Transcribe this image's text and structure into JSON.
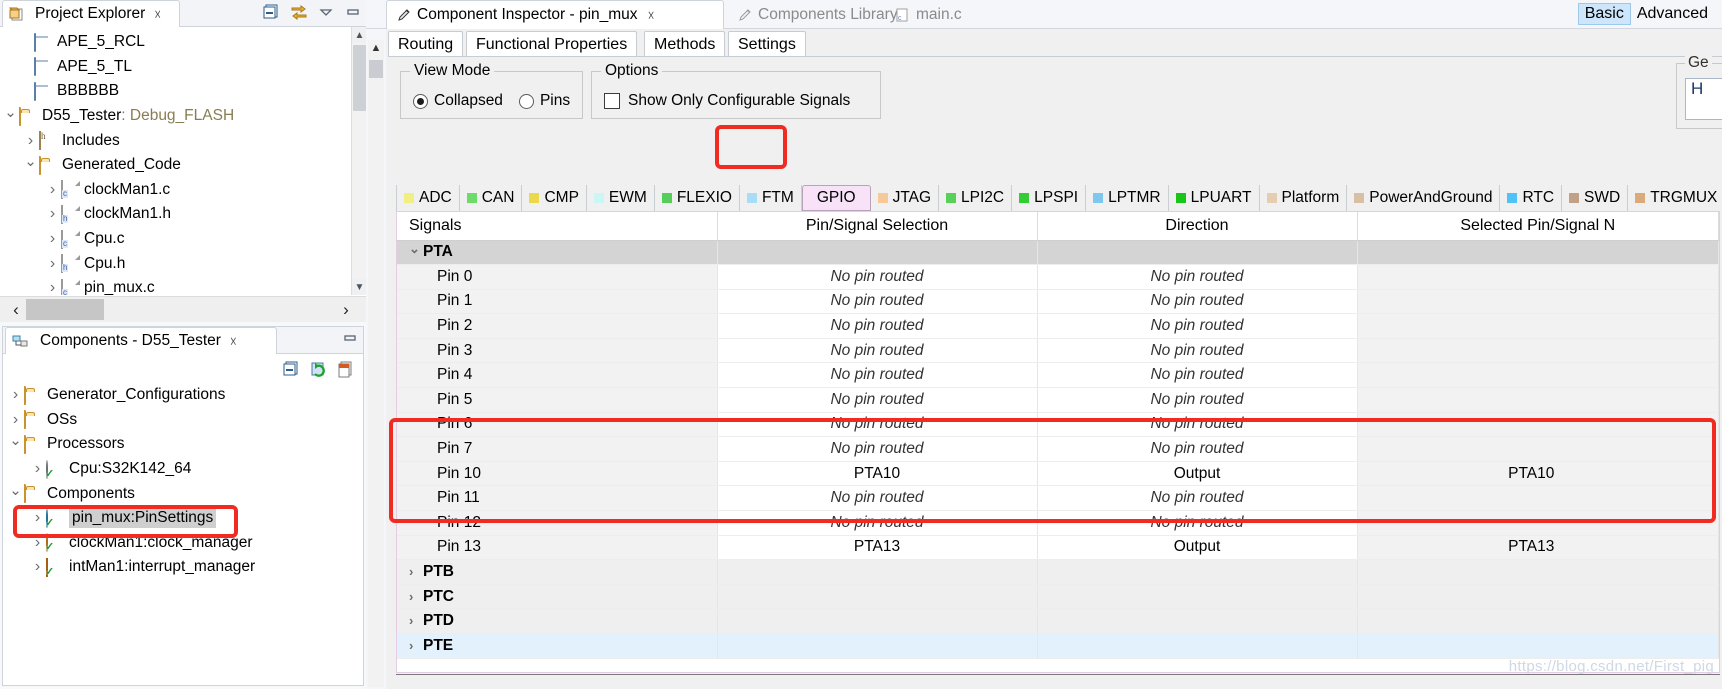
{
  "project_explorer": {
    "tab_title": "Project Explorer",
    "close_glyph": "☓",
    "toolbar": [
      "collapse-all-icon",
      "link-with-editor-icon",
      "view-menu-icon",
      "minimize-icon"
    ],
    "tree": [
      {
        "label": "APE_5_RCL",
        "icon": "project-folder-icon",
        "twisty": "none",
        "indent": 1
      },
      {
        "label": "APE_5_TL",
        "icon": "project-folder-icon",
        "twisty": "none",
        "indent": 1
      },
      {
        "label": "BBBBBB",
        "icon": "project-folder-icon",
        "twisty": "none",
        "indent": 1
      },
      {
        "label": "D55_Tester",
        "suffix": ": Debug_FLASH",
        "icon": "open-project-icon",
        "twisty": "open",
        "indent": 0
      },
      {
        "label": "Includes",
        "icon": "includes-icon",
        "twisty": "closed",
        "indent": 1
      },
      {
        "label": "Generated_Code",
        "icon": "open-folder-icon",
        "twisty": "open",
        "indent": 1
      },
      {
        "label": "clockMan1.c",
        "icon": "c-file-icon",
        "ext": ".c",
        "twisty": "closed",
        "indent": 2
      },
      {
        "label": "clockMan1.h",
        "icon": "h-file-icon",
        "ext": ".h",
        "twisty": "closed",
        "indent": 2
      },
      {
        "label": "Cpu.c",
        "icon": "c-file-icon",
        "ext": ".c",
        "twisty": "closed",
        "indent": 2
      },
      {
        "label": "Cpu.h",
        "icon": "h-file-icon",
        "ext": ".h",
        "twisty": "closed",
        "indent": 2
      },
      {
        "label": "pin_mux.c",
        "icon": "c-file-icon",
        "ext": ".c",
        "twisty": "closed",
        "indent": 2
      }
    ]
  },
  "components_view": {
    "tab_title": "Components - D55_Tester",
    "close_glyph": "☓",
    "toolbar": [
      "collapse-all-icon",
      "refresh-icon",
      "import-component-icon",
      "minimize-icon"
    ],
    "tree": [
      {
        "label": "Generator_Configurations",
        "icon": "open-folder-icon",
        "twisty": "closed",
        "indent": 0,
        "selected": false
      },
      {
        "label": "OSs",
        "icon": "open-folder-icon",
        "twisty": "closed",
        "indent": 0,
        "selected": false
      },
      {
        "label": "Processors",
        "icon": "open-folder-icon",
        "twisty": "open",
        "indent": 0,
        "selected": false
      },
      {
        "label": "Cpu:S32K142_64",
        "icon": "processor-icon",
        "twisty": "closed",
        "indent": 1,
        "selected": false
      },
      {
        "label": "Components",
        "icon": "open-folder-icon",
        "twisty": "open",
        "indent": 0,
        "selected": false
      },
      {
        "label": "pin_mux:PinSettings",
        "icon": "pin-settings-icon",
        "twisty": "closed",
        "indent": 1,
        "selected": true
      },
      {
        "label": "clockMan1:clock_manager",
        "icon": "clock-manager-icon",
        "twisty": "closed",
        "indent": 1,
        "selected": false
      },
      {
        "label": "intMan1:interrupt_manager",
        "icon": "interrupt-manager-icon",
        "twisty": "closed",
        "indent": 1,
        "selected": false
      }
    ]
  },
  "editor_tabs": [
    {
      "label": "Component Inspector - pin_mux",
      "icon": "pen-icon",
      "active": true,
      "closable": true
    },
    {
      "label": "Components Library",
      "icon": "pen-icon",
      "active": false,
      "closable": false
    },
    {
      "label": "main.c",
      "icon": "c-file-icon",
      "active": false,
      "closable": false
    }
  ],
  "mode_switch": {
    "basic": "Basic",
    "advanced": "Advanced",
    "selected": "Basic"
  },
  "inspector_tabs": [
    {
      "label": "Routing",
      "active": true
    },
    {
      "label": "Functional Properties",
      "active": false
    },
    {
      "label": "Methods",
      "active": false
    },
    {
      "label": "Settings",
      "active": false
    }
  ],
  "view_mode": {
    "title": "View Mode",
    "options": [
      {
        "label": "Collapsed",
        "selected": true
      },
      {
        "label": "Pins",
        "selected": false
      }
    ]
  },
  "options_group": {
    "title": "Options",
    "checkbox_label": "Show Only Configurable Signals",
    "checked": false
  },
  "general_group": {
    "title": "Ge",
    "field_value": "H"
  },
  "peripheral_tabs": [
    {
      "label": "ADC",
      "color": "#f1ef82",
      "active": false
    },
    {
      "label": "CAN",
      "color": "#6ddb6a",
      "active": false
    },
    {
      "label": "CMP",
      "color": "#ecd94b",
      "active": false
    },
    {
      "label": "EWM",
      "color": "#c9f7f3",
      "active": false
    },
    {
      "label": "FLEXIO",
      "color": "#56cf5a",
      "active": false
    },
    {
      "label": "FTM",
      "color": "#a8dcf7",
      "active": false
    },
    {
      "label": "GPIO",
      "color": "#f7e2f7",
      "active": true
    },
    {
      "label": "JTAG",
      "color": "#f7c89a",
      "active": false
    },
    {
      "label": "LPI2C",
      "color": "#57d157",
      "active": false
    },
    {
      "label": "LPSPI",
      "color": "#33cc33",
      "active": false
    },
    {
      "label": "LPTMR",
      "color": "#7ec8f0",
      "active": false
    },
    {
      "label": "LPUART",
      "color": "#17c617",
      "active": false
    },
    {
      "label": "Platform",
      "color": "#e6cdb0",
      "active": false
    },
    {
      "label": "PowerAndGround",
      "color": "#d8c0a5",
      "active": false
    },
    {
      "label": "RTC",
      "color": "#4fc3f7",
      "active": false
    },
    {
      "label": "SWD",
      "color": "#c2a086",
      "active": false
    },
    {
      "label": "TRGMUX",
      "color": "#dba97a",
      "active": false
    }
  ],
  "table": {
    "columns": [
      "Signals",
      "Pin/Signal Selection",
      "Direction",
      "Selected Pin/Signal N"
    ],
    "no_pin_text": "No pin routed",
    "rows": [
      {
        "type": "group",
        "signal": "PTA",
        "twisty": "open",
        "pin": "",
        "dir": "",
        "sel": ""
      },
      {
        "type": "pin",
        "signal": "Pin 0",
        "pin": "No pin routed",
        "dir": "No pin routed",
        "sel": "",
        "italic": true
      },
      {
        "type": "pin",
        "signal": "Pin 1",
        "pin": "No pin routed",
        "dir": "No pin routed",
        "sel": "",
        "italic": true
      },
      {
        "type": "pin",
        "signal": "Pin 2",
        "pin": "No pin routed",
        "dir": "No pin routed",
        "sel": "",
        "italic": true
      },
      {
        "type": "pin",
        "signal": "Pin 3",
        "pin": "No pin routed",
        "dir": "No pin routed",
        "sel": "",
        "italic": true
      },
      {
        "type": "pin",
        "signal": "Pin 4",
        "pin": "No pin routed",
        "dir": "No pin routed",
        "sel": "",
        "italic": true
      },
      {
        "type": "pin",
        "signal": "Pin 5",
        "pin": "No pin routed",
        "dir": "No pin routed",
        "sel": "",
        "italic": true
      },
      {
        "type": "pin",
        "signal": "Pin 6",
        "pin": "No pin routed",
        "dir": "No pin routed",
        "sel": "",
        "italic": true
      },
      {
        "type": "pin",
        "signal": "Pin 7",
        "pin": "No pin routed",
        "dir": "No pin routed",
        "sel": "",
        "italic": true
      },
      {
        "type": "pin",
        "signal": "Pin 10",
        "pin": "PTA10",
        "dir": "Output",
        "sel": "PTA10",
        "italic": false
      },
      {
        "type": "pin",
        "signal": "Pin 11",
        "pin": "No pin routed",
        "dir": "No pin routed",
        "sel": "",
        "italic": true
      },
      {
        "type": "pin",
        "signal": "Pin 12",
        "pin": "No pin routed",
        "dir": "No pin routed",
        "sel": "",
        "italic": true
      },
      {
        "type": "pin",
        "signal": "Pin 13",
        "pin": "PTA13",
        "dir": "Output",
        "sel": "PTA13",
        "italic": false
      },
      {
        "type": "group2",
        "signal": "PTB",
        "twisty": "closed",
        "pin": "",
        "dir": "",
        "sel": ""
      },
      {
        "type": "group2",
        "signal": "PTC",
        "twisty": "closed",
        "pin": "",
        "dir": "",
        "sel": ""
      },
      {
        "type": "group2",
        "signal": "PTD",
        "twisty": "closed",
        "pin": "",
        "dir": "",
        "sel": ""
      },
      {
        "type": "group2",
        "signal": "PTE",
        "twisty": "closed",
        "pin": "",
        "dir": "",
        "sel": "",
        "selected": true
      }
    ]
  },
  "watermark": "https://blog.csdn.net/First_pig",
  "annotations": {
    "gpio_tab_highlight": "red-rect-around-gpio-tab",
    "pin_rows_highlight": "red-rect-around-pin10-to-pin13",
    "pin_mux_component_highlight": "red-rect-around-pin-mux-pinsettings"
  },
  "colors": {
    "accent": "#ef2b22",
    "selection": "#cde6fb",
    "gpio_tab": "#f7e2f7"
  }
}
